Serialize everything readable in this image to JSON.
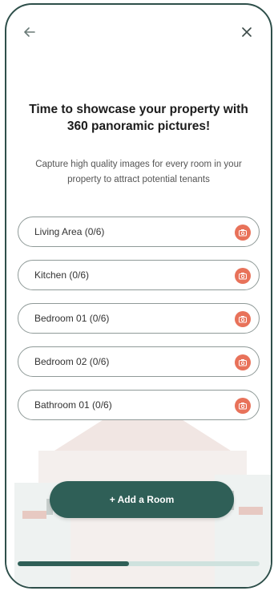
{
  "nav": {
    "back_icon": "arrow-left-icon",
    "close_icon": "close-icon"
  },
  "header": {
    "title_line1": "Time to showcase your property with",
    "title_line2": "360 panoramic pictures!",
    "subtitle": "Capture high quality images for every room in your property to attract potential tenants"
  },
  "rooms": [
    {
      "label": "Living Area (0/6)"
    },
    {
      "label": "Kitchen (0/6)"
    },
    {
      "label": "Bedroom 01 (0/6)"
    },
    {
      "label": "Bedroom 02 (0/6)"
    },
    {
      "label": "Bathroom 01 (0/6)"
    }
  ],
  "add_room_label": "+ Add a Room",
  "progress_fraction": 0.46,
  "colors": {
    "accent": "#2f5f57",
    "camera": "#e8725a",
    "progress_track": "#cfe2de"
  }
}
